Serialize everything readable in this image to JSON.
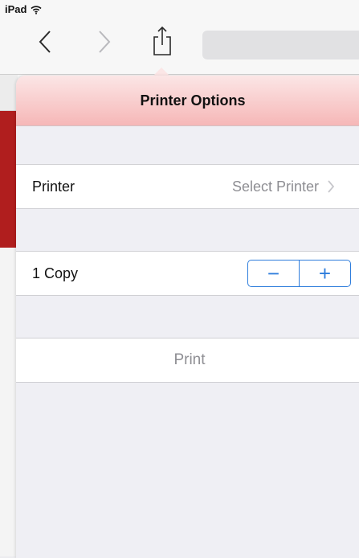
{
  "status_bar": {
    "device": "iPad",
    "wifi_icon": "wifi-icon"
  },
  "toolbar": {
    "back_icon": "chevron-left-icon",
    "forward_icon": "chevron-right-icon",
    "share_icon": "share-icon"
  },
  "popover": {
    "title": "Printer Options",
    "printer_row": {
      "label": "Printer",
      "value": "Select Printer"
    },
    "copies_row": {
      "label": "1 Copy",
      "decrement_label": "−",
      "increment_label": "+"
    },
    "print_button": {
      "label": "Print"
    }
  },
  "colors": {
    "accent": "#2e7ddc",
    "header_gradient_top": "#fbe6e6",
    "header_gradient_bottom": "#f6b7b7",
    "disabled_text": "#8e8e93",
    "page_strip": "#b01e1e"
  }
}
